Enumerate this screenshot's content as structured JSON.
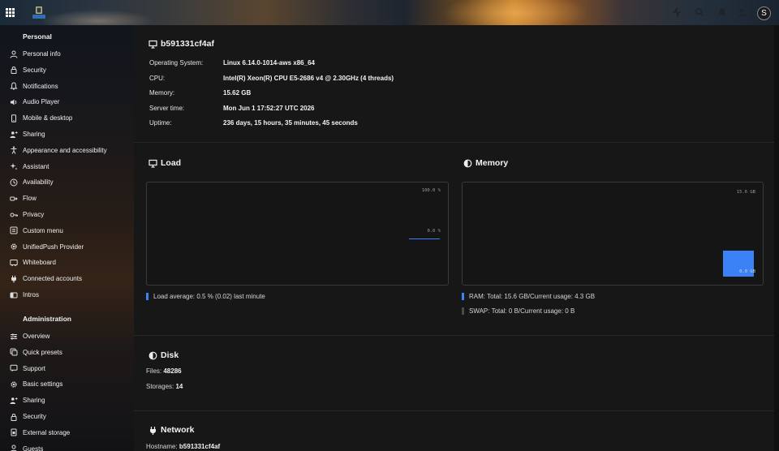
{
  "header": {
    "avatar_initial": "S"
  },
  "sidebar": {
    "personal_heading": "Personal",
    "personal_items": [
      {
        "label": "Personal info",
        "icon": "user-icon"
      },
      {
        "label": "Security",
        "icon": "lock-icon"
      },
      {
        "label": "Notifications",
        "icon": "bell-icon"
      },
      {
        "label": "Audio Player",
        "icon": "speaker-icon"
      },
      {
        "label": "Mobile & desktop",
        "icon": "phone-icon"
      },
      {
        "label": "Sharing",
        "icon": "share-user-icon"
      },
      {
        "label": "Appearance and accessibility",
        "icon": "accessibility-icon"
      },
      {
        "label": "Assistant",
        "icon": "sparkle-icon"
      },
      {
        "label": "Availability",
        "icon": "clock-icon"
      },
      {
        "label": "Flow",
        "icon": "flow-icon"
      },
      {
        "label": "Privacy",
        "icon": "key-icon"
      },
      {
        "label": "Custom menu",
        "icon": "menu-box-icon"
      },
      {
        "label": "UnifiedPush Provider",
        "icon": "gear-icon"
      },
      {
        "label": "Whiteboard",
        "icon": "whiteboard-icon"
      },
      {
        "label": "Connected accounts",
        "icon": "plug-icon"
      },
      {
        "label": "Intros",
        "icon": "intro-icon"
      }
    ],
    "admin_heading": "Administration",
    "admin_items": [
      {
        "label": "Overview",
        "icon": "sliders-icon"
      },
      {
        "label": "Quick presets",
        "icon": "presets-icon"
      },
      {
        "label": "Support",
        "icon": "chat-icon"
      },
      {
        "label": "Basic settings",
        "icon": "gear-icon"
      },
      {
        "label": "Sharing",
        "icon": "share-user-icon"
      },
      {
        "label": "Security",
        "icon": "lock-icon"
      },
      {
        "label": "External storage",
        "icon": "storage-icon"
      },
      {
        "label": "Guests",
        "icon": "user-icon"
      }
    ]
  },
  "server": {
    "hostname_title": "b591331cf4af",
    "rows": [
      {
        "label": "Operating System:",
        "value": "Linux 6.14.0-1014-aws x86_64"
      },
      {
        "label": "CPU:",
        "value": "Intel(R) Xeon(R) CPU E5-2686 v4 @ 2.30GHz (4 threads)"
      },
      {
        "label": "Memory:",
        "value": "15.62 GB"
      },
      {
        "label": "Server time:",
        "value": "Mon Jun 1 17:52:27 UTC 2026"
      },
      {
        "label": "Uptime:",
        "value": "236 days, 15 hours, 35 minutes, 45 seconds"
      }
    ]
  },
  "load": {
    "title": "Load",
    "y_max_label": "100.0 %",
    "y_cur_label": "0.0 %",
    "legend": "Load average: 0.5 % (0.02) last minute",
    "color": "#3b82f6",
    "value_fraction": 0.005
  },
  "memory": {
    "title": "Memory",
    "y_max_label": "15.6 GB",
    "y_cur_label": "0.0 GB",
    "ram_legend": "RAM: Total: 15.6 GB/Current usage: 4.3 GB",
    "swap_legend": "SWAP: Total: 0 B/Current usage: 0 B",
    "ram_color": "#3b82f6",
    "swap_color": "#4a4a4a",
    "ram_total_gb": 15.6,
    "ram_used_gb": 4.3
  },
  "disk": {
    "title": "Disk",
    "files_label": "Files:",
    "files_value": "48286",
    "storages_label": "Storages:",
    "storages_value": "14"
  },
  "network": {
    "title": "Network",
    "hostname_label": "Hostname:",
    "hostname_value": "b591331cf4af"
  }
}
